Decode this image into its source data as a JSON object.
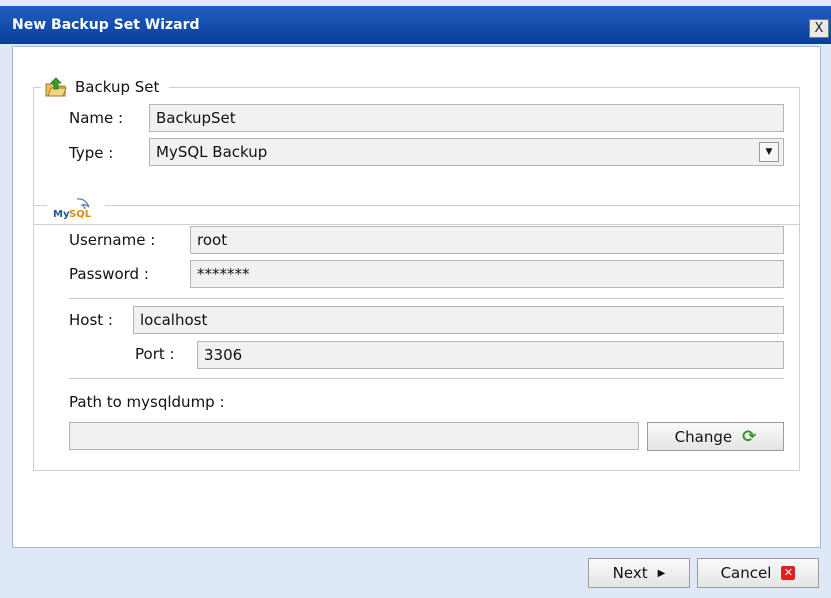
{
  "window": {
    "title": "New Backup Set Wizard",
    "close_label": "X"
  },
  "backup_set": {
    "legend": "Backup Set",
    "name_label": "Name :",
    "name_value": "BackupSet",
    "type_label": "Type :",
    "type_value": "MySQL Backup"
  },
  "mysql": {
    "logo_text": "MySQL",
    "username_label": "Username :",
    "username_value": "root",
    "password_label": "Password :",
    "password_value": "*******",
    "host_label": "Host :",
    "host_value": "localhost",
    "port_label": "Port :",
    "port_value": "3306",
    "path_label": "Path to mysqldump :",
    "path_value": "",
    "change_label": "Change"
  },
  "footer": {
    "next_label": "Next",
    "cancel_label": "Cancel"
  },
  "icons": {
    "backup-set-icon": "folder-with-green-arrow",
    "mysql-logo": "dolphin",
    "change-icon": "green-refresh",
    "next-icon": "right-triangle",
    "cancel-icon": "red-x"
  },
  "colors": {
    "titlebar": "#0a3e9c",
    "dialog_bg": "#dfe8f6",
    "cancel_red": "#e02020",
    "refresh_green": "#2b9a2b"
  }
}
